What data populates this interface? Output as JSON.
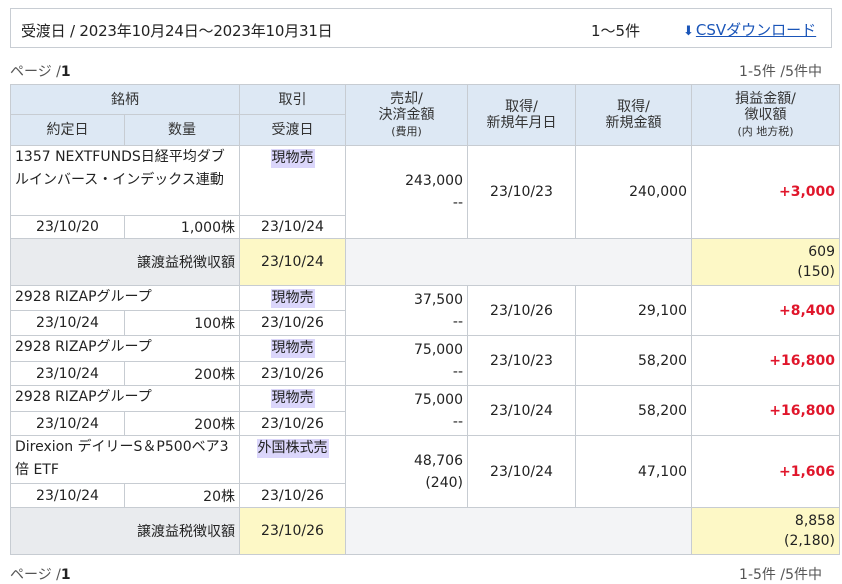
{
  "toolbar": {
    "range": "受渡日 / 2023年10月24日〜2023年10月31日",
    "count": "1〜5件",
    "csv_label": "CSVダウンロード"
  },
  "pager_top": {
    "label": "ページ /",
    "page": "1",
    "count": "1-5件 /5件中"
  },
  "pager_bottom": {
    "label": "ページ /",
    "page": "1",
    "count": "1-5件 /5件中"
  },
  "header": {
    "meigara": "銘柄",
    "yakuteibi": "約定日",
    "suryo": "数量",
    "torihiki": "取引",
    "ukewatashibi": "受渡日",
    "baikyaku_1": "売却/",
    "baikyaku_2": "決済金額",
    "baikyaku_3": "(費用)",
    "shutoku_date_1": "取得/",
    "shutoku_date_2": "新規年月日",
    "shutoku_amt_1": "取得/",
    "shutoku_amt_2": "新規金額",
    "soneki_1": "損益金額/",
    "soneki_2": "徴収額",
    "soneki_3": "(内 地方税)"
  },
  "rows": [
    {
      "name": "1357 NEXTFUNDS日経平均ダブルインバース・インデックス連動",
      "trade_date": "23/10/20",
      "qty": "1,000株",
      "type": "現物売",
      "settle_date": "23/10/24",
      "sell_amount": "243,000",
      "sell_fee": "--",
      "acq_date": "23/10/23",
      "acq_amount": "240,000",
      "pl": "+3,000"
    },
    {
      "name": "2928 RIZAPグループ",
      "trade_date": "23/10/24",
      "qty": "100株",
      "type": "現物売",
      "settle_date": "23/10/26",
      "sell_amount": "37,500",
      "sell_fee": "--",
      "acq_date": "23/10/26",
      "acq_amount": "29,100",
      "pl": "+8,400"
    },
    {
      "name": "2928 RIZAPグループ",
      "trade_date": "23/10/24",
      "qty": "200株",
      "type": "現物売",
      "settle_date": "23/10/26",
      "sell_amount": "75,000",
      "sell_fee": "--",
      "acq_date": "23/10/23",
      "acq_amount": "58,200",
      "pl": "+16,800"
    },
    {
      "name": "2928 RIZAPグループ",
      "trade_date": "23/10/24",
      "qty": "200株",
      "type": "現物売",
      "settle_date": "23/10/26",
      "sell_amount": "75,000",
      "sell_fee": "--",
      "acq_date": "23/10/24",
      "acq_amount": "58,200",
      "pl": "+16,800"
    },
    {
      "name": "Direxion デイリーS＆P500ベア3倍 ETF",
      "trade_date": "23/10/24",
      "qty": "20株",
      "type": "外国株式売",
      "settle_date": "23/10/26",
      "sell_amount": "48,706",
      "sell_fee": "(240)",
      "acq_date": "23/10/24",
      "acq_amount": "47,100",
      "pl": "+1,606"
    }
  ],
  "tax": [
    {
      "label": "譲渡益税徴収額",
      "date": "23/10/24",
      "amount": "609",
      "local": "(150)"
    },
    {
      "label": "譲渡益税徴収額",
      "date": "23/10/26",
      "amount": "8,858",
      "local": "(2,180)"
    }
  ]
}
